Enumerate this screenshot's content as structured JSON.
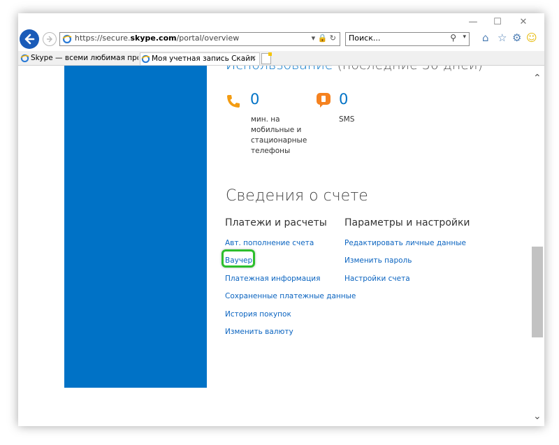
{
  "browser": {
    "url_prefix": "https://secure.",
    "url_domain": "skype.com",
    "url_path": "/portal/overview",
    "url_tools": "▾ 🔒 ↻",
    "search_placeholder": "Поиск...",
    "search_icon": "⚲",
    "window_buttons": {
      "minimize": "—",
      "maximize": "☐",
      "close": "✕"
    },
    "tabs": [
      {
        "label": "Skype — всеми любимая про..."
      },
      {
        "label": "Моя учетная запись Скайп",
        "close": "✕"
      }
    ]
  },
  "usage": {
    "title_main": "Использование",
    "title_rest": " (последние 30 дней)",
    "calls": {
      "value": "0",
      "label": "мин. на мобильные и стационарные телефоны"
    },
    "sms": {
      "value": "0",
      "label": "SMS"
    }
  },
  "account": {
    "title": "Сведения о счете",
    "payments": {
      "heading": "Платежи и расчеты",
      "links": [
        "Авт. пополнение счета",
        "Ваучер",
        "Платежная информация",
        "Сохраненные платежные данные",
        "История покупок",
        "Изменить валюту"
      ]
    },
    "settings": {
      "heading": "Параметры и настройки",
      "links": [
        "Редактировать личные данные",
        "Изменить пароль",
        "Настройки счета"
      ]
    }
  },
  "colors": {
    "accent": "#0072c6",
    "highlight": "#2dbf2d",
    "phone_icon": "#f39c12",
    "sms_icon": "#f58220"
  }
}
